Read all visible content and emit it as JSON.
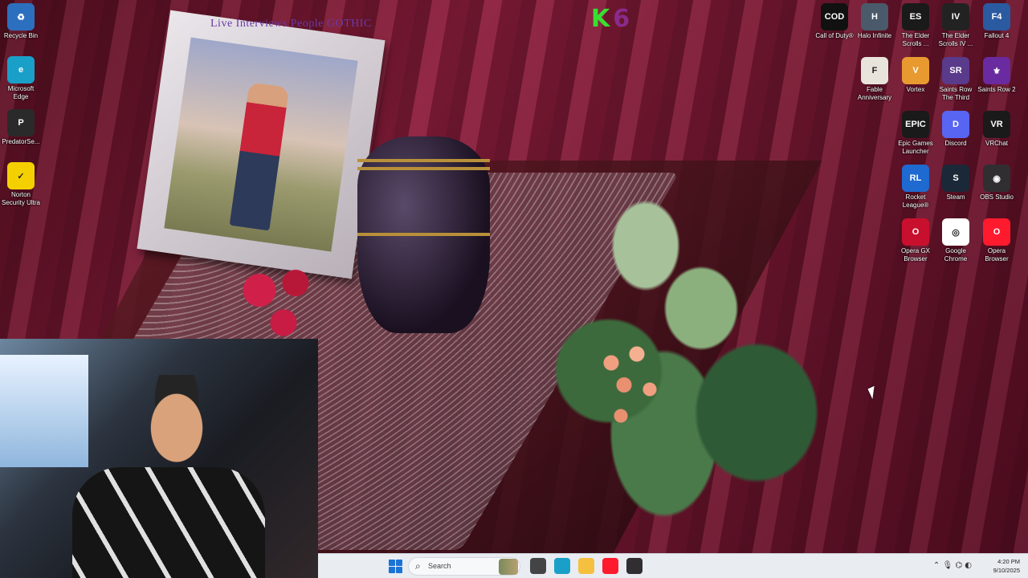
{
  "overlay": {
    "stream_text": "Live Interviews People GOTHIC",
    "logo_k1": "K",
    "logo_k2": "6"
  },
  "desktop_icons_left": [
    {
      "label": "Recycle Bin",
      "glyph": "♻",
      "color": "#2d6fbf"
    },
    {
      "label": "Microsoft Edge",
      "glyph": "e",
      "color": "#1aa0c8"
    },
    {
      "label": "PredatorSe...",
      "glyph": "P",
      "color": "#2a2a2a"
    },
    {
      "label": "Norton Security Ultra",
      "glyph": "✓",
      "color": "#f5d000"
    }
  ],
  "desktop_icons_right": [
    [
      {
        "label": "Call of Duty®",
        "glyph": "COD",
        "color": "#111111"
      },
      {
        "label": "Halo Infinite",
        "glyph": "H",
        "color": "#4a5a6a"
      },
      {
        "label": "The Elder Scrolls ...",
        "glyph": "ES",
        "color": "#1a1a1a"
      },
      {
        "label": "The Elder Scrolls IV ...",
        "glyph": "IV",
        "color": "#222222"
      },
      {
        "label": "Fallout 4",
        "glyph": "F4",
        "color": "#2a5aa0"
      }
    ],
    [
      {
        "label": "Fable Anniversary",
        "glyph": "F",
        "color": "#e8e4dc"
      },
      {
        "label": "Vortex",
        "glyph": "V",
        "color": "#e89a30"
      },
      {
        "label": "Saints Row The Third",
        "glyph": "SR",
        "color": "#5a3a8a"
      },
      {
        "label": "Saints Row 2",
        "glyph": "⚜",
        "color": "#6a2aa0"
      }
    ],
    [
      {
        "label": "Epic Games Launcher",
        "glyph": "EPIC",
        "color": "#1a1a1a"
      },
      {
        "label": "Discord",
        "glyph": "D",
        "color": "#5865f2"
      },
      {
        "label": "VRChat",
        "glyph": "VR",
        "color": "#1a1a1a"
      }
    ],
    [
      {
        "label": "Rocket League®",
        "glyph": "RL",
        "color": "#1e6ad0"
      },
      {
        "label": "Steam",
        "glyph": "S",
        "color": "#1b2838"
      },
      {
        "label": "OBS Studio",
        "glyph": "◉",
        "color": "#302e31"
      }
    ],
    [
      {
        "label": "Opera GX Browser",
        "glyph": "O",
        "color": "#c8102e"
      },
      {
        "label": "Google Chrome",
        "glyph": "◎",
        "color": "#ffffff"
      },
      {
        "label": "Opera Browser",
        "glyph": "O",
        "color": "#ff1b2d"
      }
    ]
  ],
  "taskbar": {
    "search_placeholder": "Search",
    "apps": [
      {
        "name": "task-view",
        "color": "#444444"
      },
      {
        "name": "edge",
        "color": "#1aa0c8"
      },
      {
        "name": "file-explorer",
        "color": "#f5c040"
      },
      {
        "name": "opera",
        "color": "#ff1b2d"
      },
      {
        "name": "obs",
        "color": "#302e31"
      }
    ],
    "tray_icons": "⌃ 🎙 ⌬ ◐",
    "time": "4:20 PM",
    "date": "9/10/2025"
  }
}
